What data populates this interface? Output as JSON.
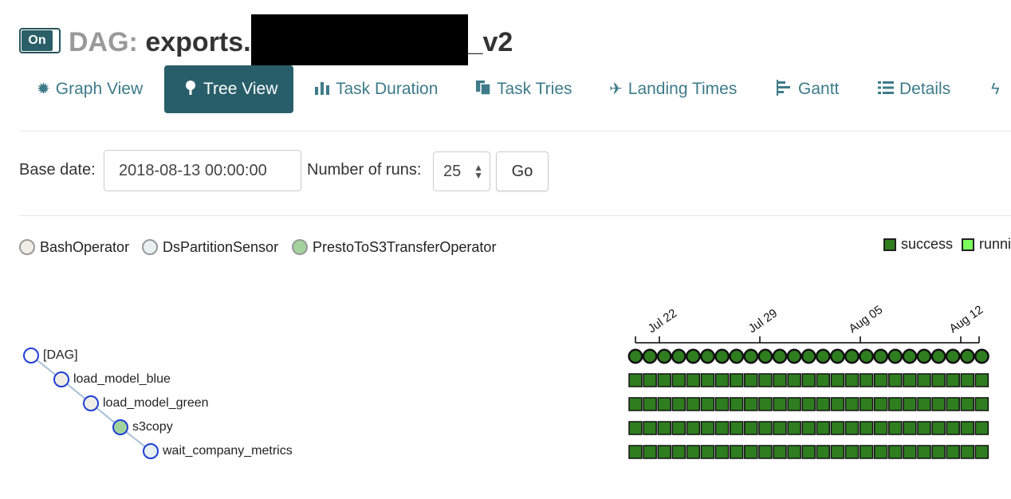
{
  "header": {
    "toggle_label": "On",
    "dag_prefix": "DAG:",
    "dag_name_start": "exports.",
    "dag_name_end": "_v2"
  },
  "nav": {
    "items": [
      {
        "label": "Graph View",
        "icon": "sun-icon"
      },
      {
        "label": "Tree View",
        "icon": "tree-icon",
        "active": true
      },
      {
        "label": "Task Duration",
        "icon": "bar-chart-icon"
      },
      {
        "label": "Task Tries",
        "icon": "files-icon"
      },
      {
        "label": "Landing Times",
        "icon": "plane-icon"
      },
      {
        "label": "Gantt",
        "icon": "gantt-icon"
      },
      {
        "label": "Details",
        "icon": "list-icon"
      }
    ],
    "overflow_icon": "flash-icon"
  },
  "form": {
    "base_date_label": "Base date:",
    "base_date_value": "2018-08-13 00:00:00",
    "num_runs_label": "Number of runs:",
    "num_runs_value": "25",
    "go_label": "Go"
  },
  "operator_legend": [
    {
      "name": "BashOperator",
      "color": "#f0ede4"
    },
    {
      "name": "DsPartitionSensor",
      "color": "#e8f0f1"
    },
    {
      "name": "PrestoToS3TransferOperator",
      "color": "#a3d39c"
    }
  ],
  "state_legend": [
    {
      "name": "success",
      "color": "#2e7d1f"
    },
    {
      "name": "runni",
      "color": "#7cfc5a"
    }
  ],
  "tree": {
    "nodes": [
      {
        "label": "[DAG]",
        "fill": "#ffffff",
        "depth": 0
      },
      {
        "label": "load_model_blue",
        "fill": "#f0ede4",
        "depth": 1
      },
      {
        "label": "load_model_green",
        "fill": "#f0ede4",
        "depth": 2
      },
      {
        "label": "s3copy",
        "fill": "#a3d39c",
        "depth": 3
      },
      {
        "label": "wait_company_metrics",
        "fill": "#e8f0f1",
        "depth": 4
      }
    ]
  },
  "grid": {
    "runs": 25,
    "rows": 5,
    "state": "success",
    "success_color": "#2e7d1f",
    "axis_ticks": [
      "Jul 22",
      "Jul 29",
      "Aug 05",
      "Aug 12"
    ]
  }
}
